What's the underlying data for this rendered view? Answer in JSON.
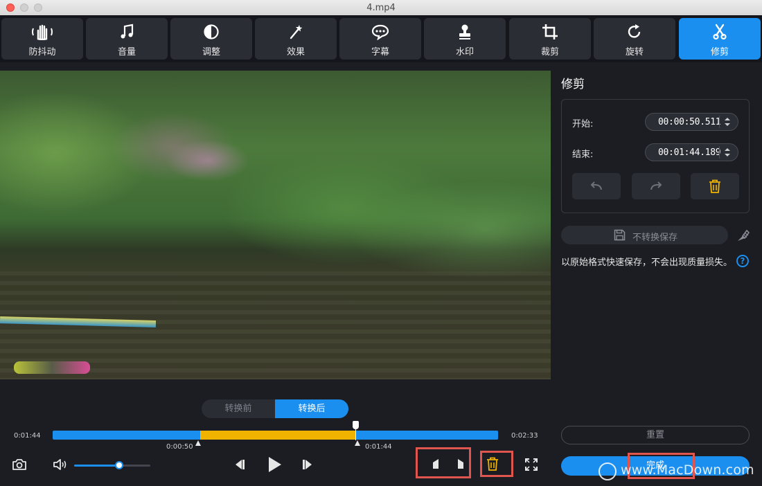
{
  "window": {
    "title": "4.mp4"
  },
  "toolbar": {
    "items": [
      {
        "label": "防抖动",
        "icon": "hand-stabilize-icon"
      },
      {
        "label": "音量",
        "icon": "music-note-icon"
      },
      {
        "label": "调整",
        "icon": "contrast-icon"
      },
      {
        "label": "效果",
        "icon": "magic-wand-icon"
      },
      {
        "label": "字幕",
        "icon": "speech-bubble-icon"
      },
      {
        "label": "水印",
        "icon": "stamp-icon"
      },
      {
        "label": "裁剪",
        "icon": "crop-icon"
      },
      {
        "label": "旋转",
        "icon": "rotate-icon"
      },
      {
        "label": "修剪",
        "icon": "scissors-icon",
        "active": true
      }
    ]
  },
  "preview": {
    "tabs": {
      "before": "转换前",
      "after": "转换后",
      "active": "after"
    }
  },
  "timeline": {
    "left_time": "0:01:44",
    "right_time": "0:02:33",
    "start_marker": "0:00:50",
    "end_marker": "0:01:44",
    "selection_start_fraction": 0.331,
    "selection_end_fraction": 0.681,
    "playhead_fraction": 0.681
  },
  "controls": {
    "volume_fraction": 0.59,
    "icons": [
      "camera-icon",
      "speaker-icon",
      "previous-frame-icon",
      "play-icon",
      "next-frame-icon",
      "set-start-icon",
      "set-end-icon",
      "delete-icon",
      "fullscreen-icon"
    ]
  },
  "panel": {
    "title": "修剪",
    "start_label": "开始:",
    "start_value": "00:00:50.511",
    "end_label": "结束:",
    "end_value": "00:01:44.189",
    "save_button": "不转换保存",
    "description": "以原始格式快速保存，不会出现质量损失。",
    "help": "?",
    "reset_button": "重置",
    "done_button": "完成"
  },
  "watermark": {
    "text": "www.MacDown.com"
  },
  "colors": {
    "accent": "#1b8fef",
    "selection": "#f0b400",
    "highlight_box": "#e0554d",
    "delete": "#f0b400"
  }
}
